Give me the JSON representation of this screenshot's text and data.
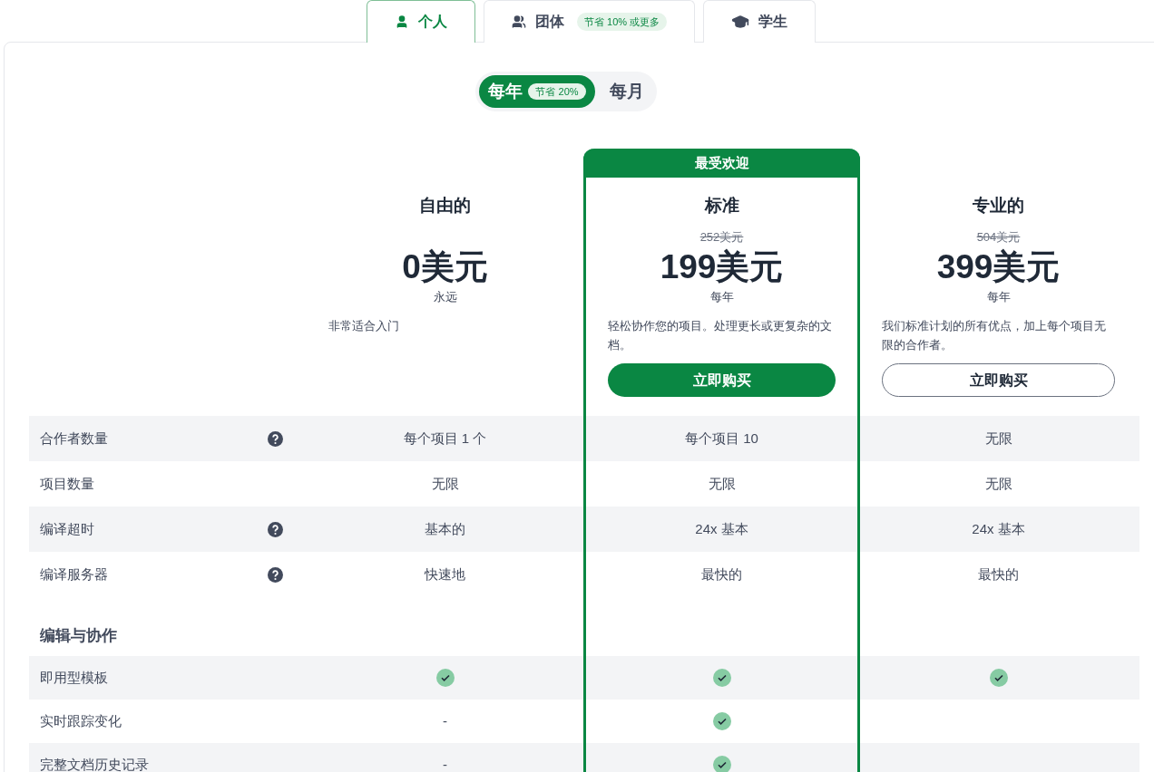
{
  "tabs": [
    {
      "label": "个人",
      "selected": true
    },
    {
      "label": "团体",
      "badge": "节省 10% 或更多",
      "selected": false
    },
    {
      "label": "学生",
      "selected": false
    }
  ],
  "billing": [
    {
      "label": "每年",
      "badge": "节省 20%",
      "selected": true
    },
    {
      "label": "每月",
      "selected": false
    }
  ],
  "plans": [
    {
      "name": "自由的",
      "price": "0美元",
      "period": "永远",
      "description": "非常适合入门"
    },
    {
      "name": "标准",
      "popular_label": "最受欢迎",
      "original_price": "252美元",
      "price": "199美元",
      "period": "每年",
      "description": "轻松协作您的项目。处理更长或更复杂的文档。",
      "button": {
        "label": "立即购买",
        "kind": "primary"
      }
    },
    {
      "name": "专业的",
      "original_price": "504美元",
      "price": "399美元",
      "period": "每年",
      "description": "我们标准计划的所有优点，加上每个项目无限的合作者。",
      "button": {
        "label": "立即购买",
        "kind": "outline"
      }
    }
  ],
  "sections": [
    {
      "rows": [
        {
          "label": "合作者数量",
          "help": true,
          "cells": [
            {
              "kind": "text",
              "text": "每个项目 1 个"
            },
            {
              "kind": "text",
              "text": "每个项目 10"
            },
            {
              "kind": "text",
              "text": "无限"
            }
          ]
        },
        {
          "label": "项目数量",
          "help": false,
          "cells": [
            {
              "kind": "text",
              "text": "无限"
            },
            {
              "kind": "text",
              "text": "无限"
            },
            {
              "kind": "text",
              "text": "无限"
            }
          ]
        },
        {
          "label": "编译超时",
          "help": true,
          "cells": [
            {
              "kind": "text",
              "text": "基本的"
            },
            {
              "kind": "text",
              "text": "24x 基本"
            },
            {
              "kind": "text",
              "text": "24x 基本"
            }
          ]
        },
        {
          "label": "编译服务器",
          "help": true,
          "cells": [
            {
              "kind": "text",
              "text": "快速地"
            },
            {
              "kind": "text",
              "text": "最快的"
            },
            {
              "kind": "text",
              "text": "最快的"
            }
          ]
        }
      ]
    },
    {
      "title": "编辑与协作",
      "rows": [
        {
          "label": "即用型模板",
          "help": false,
          "cells": [
            {
              "kind": "check"
            },
            {
              "kind": "check"
            },
            {
              "kind": "check"
            }
          ]
        },
        {
          "label": "实时跟踪变化",
          "help": false,
          "cells": [
            {
              "kind": "text",
              "text": "-"
            },
            {
              "kind": "check"
            }
          ]
        },
        {
          "label": "完整文档历史记录",
          "help": false,
          "cells": [
            {
              "kind": "text",
              "text": "-"
            },
            {
              "kind": "check"
            }
          ]
        }
      ]
    }
  ]
}
